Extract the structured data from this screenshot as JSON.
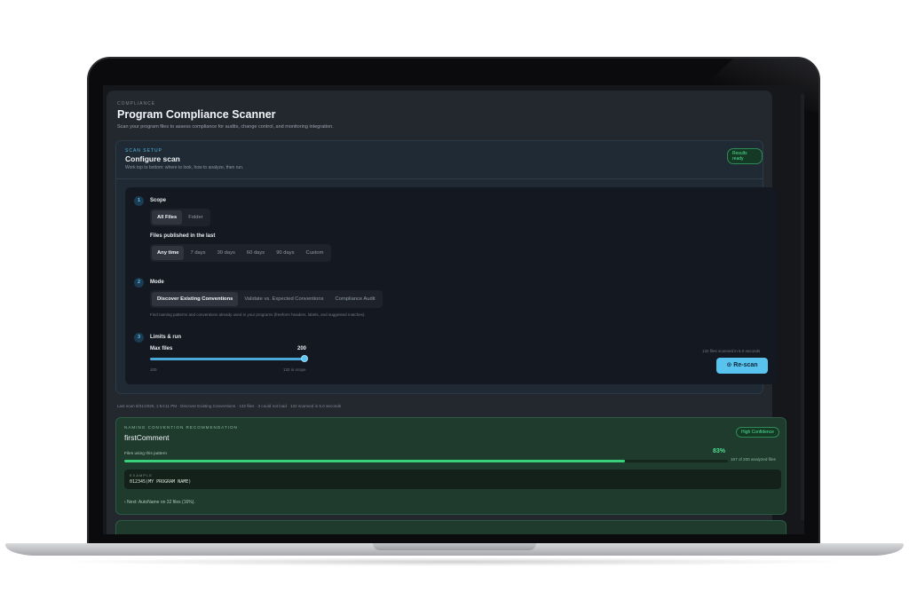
{
  "header": {
    "kicker": "COMPLIANCE",
    "title": "Program Compliance Scanner",
    "subtitle": "Scan your program files to assess compliance for audits, change control, and monitoring integration."
  },
  "setup": {
    "kicker": "SCAN SETUP",
    "title": "Configure scan",
    "subtitle": "Work top to bottom: where to look, how to analyze, then run.",
    "status_badge": "Results ready",
    "steps": {
      "scope": {
        "number": "1",
        "title": "Scope",
        "options": [
          "All Files",
          "Folder"
        ],
        "selected": "All Files",
        "published_label": "Files published in the last",
        "published_options": [
          "Any time",
          "7 days",
          "30 days",
          "60 days",
          "90 days",
          "Custom"
        ],
        "published_selected": "Any time"
      },
      "mode": {
        "number": "2",
        "title": "Mode",
        "options": [
          "Discover Existing Conventions",
          "Validate vs. Expected Conventions",
          "Compliance Audit"
        ],
        "selected": "Discover Existing Conventions",
        "hint": "Find naming patterns and conventions already used in your programs (freeform headers, labels, and suggested matches)."
      },
      "limits": {
        "number": "3",
        "title": "Limits & run",
        "max_files_label": "Max files",
        "max_files_value": "200",
        "slider_min_label": "100",
        "slider_max_label": "132 in scope",
        "slider_fraction": 1.0,
        "scanned_note": "132 files scanned in 5.0 seconds",
        "rescan_label": "Re-scan"
      }
    }
  },
  "last_scan": "Last scan 8/31/2025, 1:54:11 PM · Discover Existing Conventions · 132 files · 3 could not load · 132 scanned in 5.0 seconds",
  "recommendation": {
    "kicker": "NAMING CONVENTION RECOMMENDATION",
    "title": "firstComment",
    "badge": "High Confidence",
    "using_label": "Files using this pattern",
    "percent": "83%",
    "fraction": 0.83,
    "count": "167 of 200 analyzed files",
    "example_label": "EXAMPLE",
    "example_value": "012345(MY PROGRAM NAME)",
    "next": "› Next: AutoName on 32 files (16%)."
  },
  "colors": {
    "accent": "#59c3ef",
    "success": "#4ee08d",
    "panel": "#1f2a34",
    "reco_panel": "#1f3b2e"
  },
  "icons": {
    "rescan": "refresh-circle-icon"
  }
}
